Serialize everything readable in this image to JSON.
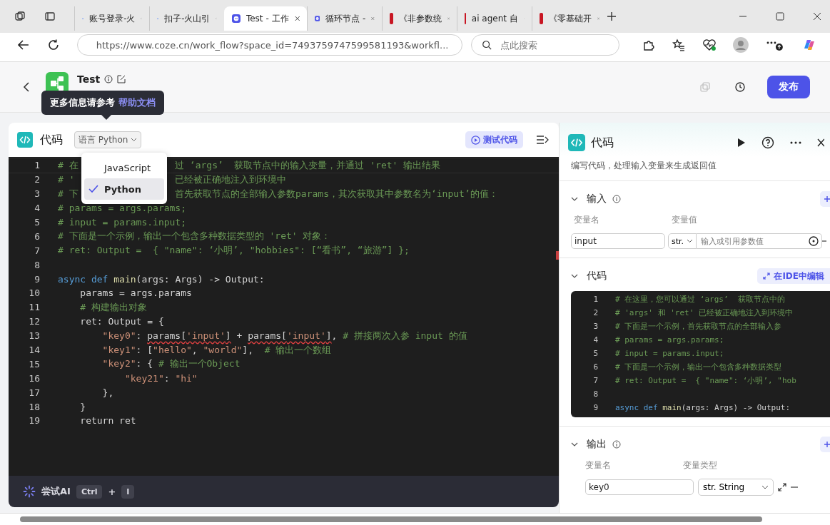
{
  "browser": {
    "tabs": [
      {
        "kind": "ark",
        "title": "账号登录-火",
        "selected": false
      },
      {
        "kind": "ark",
        "title": "扣子-火山引",
        "selected": false
      },
      {
        "kind": "coze",
        "title": "Test - 工作",
        "selected": true
      },
      {
        "kind": "coze",
        "title": "循环节点 -",
        "selected": false
      },
      {
        "kind": "jd",
        "title": "《非参数统",
        "selected": false
      },
      {
        "kind": "jd",
        "title": "ai agent 自",
        "selected": false
      },
      {
        "kind": "jd",
        "title": "《零基础开",
        "selected": false
      }
    ],
    "address": "https://www.coze.cn/work_flow?space_id=7493759747599581193&workfl...",
    "search": {
      "placeholder": "点此搜索"
    }
  },
  "header": {
    "title": "Test",
    "tooltip": {
      "text": "更多信息请参考 ",
      "link": "帮助文档"
    },
    "publish": "发布"
  },
  "editor": {
    "title": "代码",
    "language": {
      "label": "语言 Python",
      "options": [
        {
          "label": "JavaScript",
          "selected": false
        },
        {
          "label": "Python",
          "selected": true
        }
      ]
    },
    "test_button": "测试代码",
    "lines": [
      {
        "number": "1",
        "segments": [
          {
            "kind": "comment",
            "text": "# 在"
          },
          {
            "kind": "covered"
          },
          {
            "kind": "comment",
            "text": "过 ‘args’  获取节点中的输入变量，并通过 'ret' 输出结果"
          }
        ]
      },
      {
        "number": "2",
        "segments": [
          {
            "kind": "comment",
            "text": "# '"
          },
          {
            "kind": "covered"
          },
          {
            "kind": "comment",
            "text": "已经被正确地注入到环境中"
          }
        ]
      },
      {
        "number": "3",
        "segments": [
          {
            "kind": "comment",
            "text": "# 下"
          },
          {
            "kind": "covered"
          },
          {
            "kind": "comment",
            "text": "首先获取节点的全部输入参数params，其次获取其中参数名为‘input’的值："
          }
        ]
      },
      {
        "number": "4",
        "segments": [
          {
            "kind": "comment",
            "text": "# params = args.params;"
          }
        ]
      },
      {
        "number": "5",
        "segments": [
          {
            "kind": "comment",
            "text": "# input = params.input;"
          }
        ]
      },
      {
        "number": "6",
        "segments": [
          {
            "kind": "comment",
            "text": "# 下面是一个示例，输出一个包含多种数据类型的 'ret' 对象："
          }
        ]
      },
      {
        "number": "7",
        "segments": [
          {
            "kind": "comment",
            "text": "# ret: Output =  { \"name\": ‘小明’, \"hobbies\": [“看书”, “旅游”] };"
          }
        ]
      },
      {
        "number": "8"
      },
      {
        "number": "9",
        "segments": [
          {
            "kind": "keyword",
            "text": "async def "
          },
          {
            "kind": "function",
            "text": "main"
          },
          {
            "kind": "plain",
            "text": "(args: Args) -> Output:"
          }
        ]
      },
      {
        "number": "10",
        "segments": [
          {
            "kind": "plain",
            "text": "    params = args.params"
          }
        ]
      },
      {
        "number": "11",
        "segments": [
          {
            "kind": "comment",
            "text": "    # 构建输出对象"
          }
        ]
      },
      {
        "number": "12",
        "segments": [
          {
            "kind": "plain",
            "text": "    ret: Output = {"
          }
        ]
      },
      {
        "number": "13",
        "segments": [
          {
            "kind": "string",
            "text": "        \"key0\""
          },
          {
            "kind": "plain",
            "text": ": "
          },
          {
            "kind": "error",
            "text": "params["
          },
          {
            "kind": "error_string",
            "text": "'input'"
          },
          {
            "kind": "error",
            "text": "]"
          },
          {
            "kind": "plain",
            "text": " + "
          },
          {
            "kind": "error",
            "text": "params["
          },
          {
            "kind": "error_string",
            "text": "'input'"
          },
          {
            "kind": "error",
            "text": "]"
          },
          {
            "kind": "plain",
            "text": ", "
          },
          {
            "kind": "comment",
            "text": "# 拼接两次入参 input 的值"
          }
        ]
      },
      {
        "number": "14",
        "segments": [
          {
            "kind": "string",
            "text": "        \"key1\""
          },
          {
            "kind": "plain",
            "text": ": ["
          },
          {
            "kind": "string",
            "text": "\"hello\""
          },
          {
            "kind": "plain",
            "text": ", "
          },
          {
            "kind": "string",
            "text": "\"world\""
          },
          {
            "kind": "plain",
            "text": "],  "
          },
          {
            "kind": "comment",
            "text": "# 输出一个数组"
          }
        ]
      },
      {
        "number": "15",
        "segments": [
          {
            "kind": "string",
            "text": "        \"key2\""
          },
          {
            "kind": "plain",
            "text": ": { "
          },
          {
            "kind": "comment",
            "text": "# 输出一个Object"
          }
        ]
      },
      {
        "number": "16",
        "segments": [
          {
            "kind": "string",
            "text": "            \"key21\""
          },
          {
            "kind": "plain",
            "text": ": "
          },
          {
            "kind": "string",
            "text": "\"hi\""
          }
        ]
      },
      {
        "number": "17",
        "segments": [
          {
            "kind": "plain",
            "text": "        },"
          }
        ]
      },
      {
        "number": "18",
        "segments": [
          {
            "kind": "plain",
            "text": "    }"
          }
        ]
      },
      {
        "number": "19",
        "segments": [
          {
            "kind": "plain",
            "text": "    return ret"
          }
        ]
      }
    ],
    "ai": {
      "label": "尝试AI",
      "keys": [
        "Ctrl",
        "+",
        "I"
      ]
    }
  },
  "panel": {
    "title": "代码",
    "description": "编写代码，处理输入变量来生成返回值",
    "input": {
      "title": "输入",
      "columns": [
        "变量名",
        "变量值"
      ],
      "rows": [
        {
          "name": "input",
          "type": "str.",
          "placeholder": "输入或引用参数值"
        }
      ]
    },
    "code": {
      "title": "代码",
      "ide_button": "在IDE中编辑",
      "lines": [
        {
          "number": "1",
          "segments": [
            {
              "kind": "comment",
              "text": "# 在这里，您可以通过 ‘args’  获取节点中的"
            }
          ]
        },
        {
          "number": "2",
          "segments": [
            {
              "kind": "comment",
              "text": "# 'args' 和 'ret' 已经被正确地注入到环境中"
            }
          ]
        },
        {
          "number": "3",
          "segments": [
            {
              "kind": "comment",
              "text": "# 下面是一个示例，首先获取节点的全部输入参"
            }
          ]
        },
        {
          "number": "4",
          "segments": [
            {
              "kind": "comment",
              "text": "# params = args.params;"
            }
          ]
        },
        {
          "number": "5",
          "segments": [
            {
              "kind": "comment",
              "text": "# input = params.input;"
            }
          ]
        },
        {
          "number": "6",
          "segments": [
            {
              "kind": "comment",
              "text": "# 下面是一个示例，输出一个包含多种数据类型"
            }
          ]
        },
        {
          "number": "7",
          "segments": [
            {
              "kind": "comment",
              "text": "# ret: Output =  { \"name\": ‘小明’, \"hob"
            }
          ]
        },
        {
          "number": "8"
        },
        {
          "number": "9",
          "segments": [
            {
              "kind": "keyword",
              "text": "async def "
            },
            {
              "kind": "function",
              "text": "main"
            },
            {
              "kind": "plain",
              "text": "(args: Args) -> Output:"
            }
          ]
        }
      ]
    },
    "output": {
      "title": "输出",
      "columns": [
        "变量名",
        "变量类型"
      ],
      "rows": [
        {
          "name": "key0",
          "type": "str. String"
        }
      ]
    }
  }
}
